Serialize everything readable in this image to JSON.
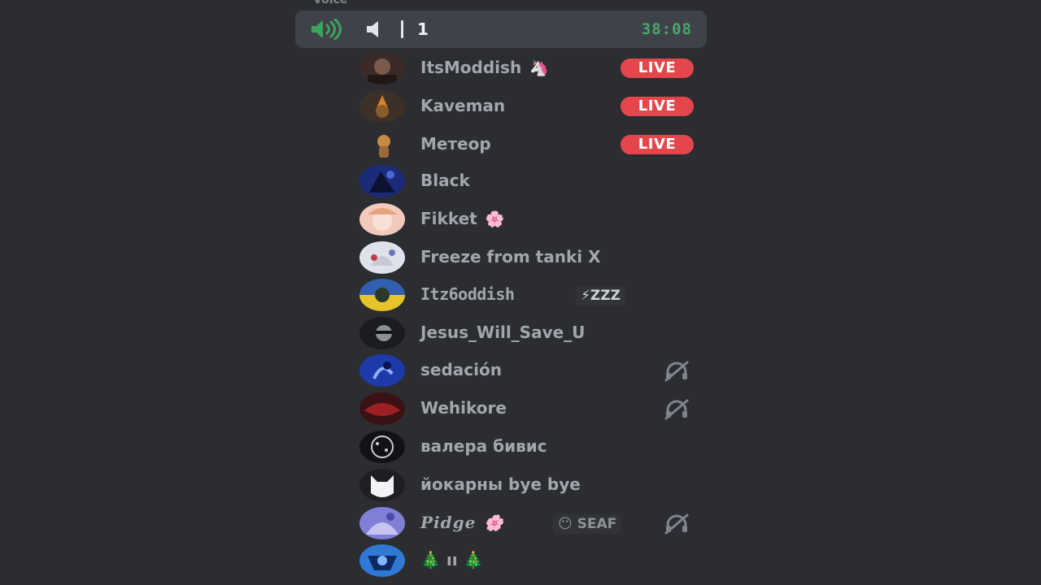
{
  "header_fragment": "Voice",
  "voice_channel": {
    "user_count": "1",
    "timer": "38:08"
  },
  "members": [
    {
      "name": "ItsModdish",
      "decor": "🦄",
      "live": "LIVE"
    },
    {
      "name": "Kaveman",
      "live": "LIVE"
    },
    {
      "name": "Метеор",
      "live": "LIVE"
    },
    {
      "name": "Black"
    },
    {
      "name": "Fikket",
      "decor": "🌸"
    },
    {
      "name": "Freeze from tanki X"
    },
    {
      "name": "Itz6oddish",
      "status": "⚡ZZZ"
    },
    {
      "name": "Jesus_Will_Save_U"
    },
    {
      "name": "sedación",
      "deafened": true
    },
    {
      "name": "Wehikore",
      "deafened": true
    },
    {
      "name": "валера бивис"
    },
    {
      "name": "йокарны bye bye"
    },
    {
      "name": "Pidge",
      "decor": "🌸",
      "status": "😶 SEAF",
      "deafened": true
    },
    {
      "name": "🎄 ıı 🎄"
    }
  ],
  "colors": {
    "background": "#2b2d31",
    "header_bg": "#404249",
    "live_badge": "#e3474b",
    "timer": "#4aa76c",
    "speaker_active": "#3ba55c"
  }
}
